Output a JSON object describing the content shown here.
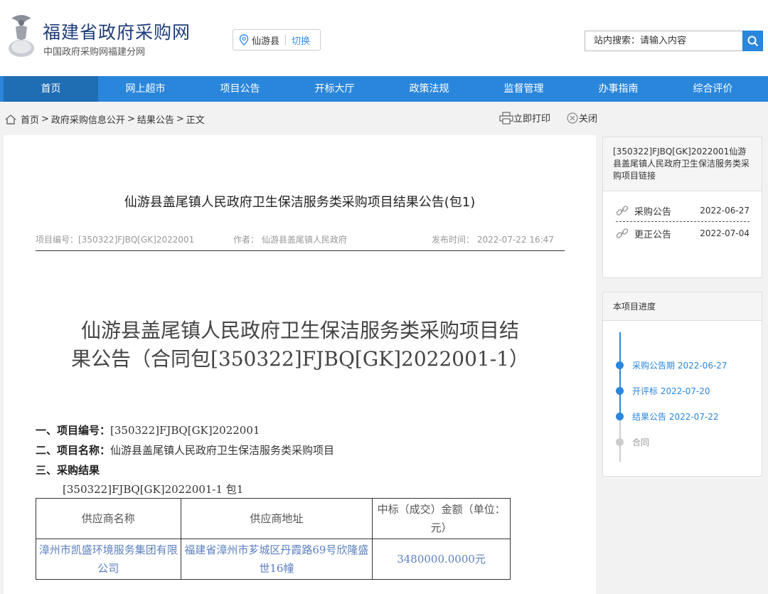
{
  "header": {
    "site_title": "福建省政府采购网",
    "site_subtitle": "中国政府采购网福建分网",
    "location": "仙游县",
    "switch_label": "切换",
    "search_placeholder": "站内搜索：请输入内容"
  },
  "nav": [
    {
      "label": "首页",
      "active": true
    },
    {
      "label": "网上超市"
    },
    {
      "label": "项目公告"
    },
    {
      "label": "开标大厅"
    },
    {
      "label": "政策法规"
    },
    {
      "label": "监督管理"
    },
    {
      "label": "办事指南"
    },
    {
      "label": "综合评价"
    }
  ],
  "breadcrumb": {
    "items": [
      "首页",
      "政府采购信息公开",
      "结果公告",
      "正文"
    ],
    "separator": ">"
  },
  "tools": {
    "print": "立即打印",
    "close": "关闭"
  },
  "article": {
    "title": "仙游县盖尾镇人民政府卫生保洁服务类采购项目结果公告(包1)",
    "meta": {
      "project_no": "项目编号：[350322]FJBQ[GK]2022001",
      "author": "作者：  仙游县盖尾镇人民政府",
      "publish_time": "发布时间：  2022-07-22 16:47"
    },
    "big_title_line1": "仙游县盖尾镇人民政府卫生保洁服务类采购项目结",
    "big_title_line2": "果公告（合同包[350322]FJBQ[GK]2022001-1）",
    "sec1_label": "一、项目编号：",
    "sec1_value": "[350322]FJBQ[GK]2022001",
    "sec2_label": "二、项目名称：",
    "sec2_value": "仙游县盖尾镇人民政府卫生保洁服务类采购项目",
    "sec3_label": "三、采购结果",
    "package_line": "[350322]FJBQ[GK]2022001-1 包1",
    "table": {
      "headers": [
        "供应商名称",
        "供应商地址",
        "中标（成交）金额（单位：元）"
      ],
      "rows": [
        [
          "漳州市凯盛环境服务集团有限公司",
          "福建省漳州市芗城区丹霞路69号欣隆盛世16幢",
          "3480000.0000元"
        ]
      ]
    }
  },
  "side_links": {
    "header": "[350322]FJBQ[GK]2022001仙游县盖尾镇人民政府卫生保洁服务类采购项目链接",
    "items": [
      {
        "label": "采购公告",
        "date": "2022-06-27"
      },
      {
        "label": "更正公告",
        "date": "2022-07-04"
      }
    ]
  },
  "progress": {
    "header": "本项目进度",
    "steps": [
      {
        "label": "采购公告期 2022-06-27",
        "done": true
      },
      {
        "label": "开评标 2022-07-20",
        "done": true
      },
      {
        "label": "结果公告 2022-07-22",
        "done": true
      },
      {
        "label": "合同",
        "done": false
      }
    ]
  },
  "colors": {
    "brand_blue": "#2a86db",
    "nav_active": "#1f6db3"
  }
}
